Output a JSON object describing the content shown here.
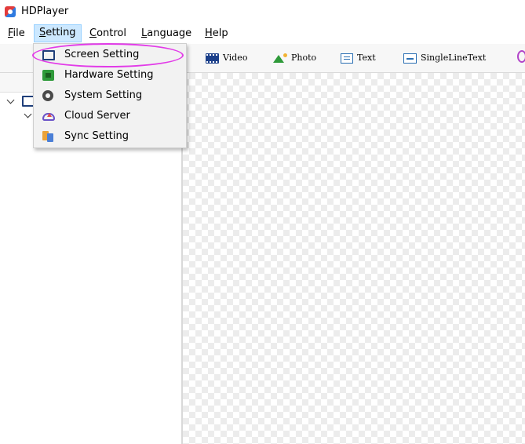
{
  "window": {
    "title": "HDPlayer",
    "app_icon": "hdplayer-app-icon"
  },
  "menubar": {
    "items": [
      {
        "label": "File",
        "accel": "F",
        "rest": "ile",
        "active": false
      },
      {
        "label": "Setting",
        "accel": "S",
        "rest": "etting",
        "active": true
      },
      {
        "label": "Control",
        "accel": "C",
        "rest": "ontrol",
        "active": false
      },
      {
        "label": "Language",
        "accel": "L",
        "rest": "anguage",
        "active": false
      },
      {
        "label": "Help",
        "accel": "H",
        "rest": "elp",
        "active": false
      }
    ]
  },
  "toolbar": {
    "items": [
      {
        "label": "Video",
        "icon": "video-icon"
      },
      {
        "label": "Photo",
        "icon": "photo-icon"
      },
      {
        "label": "Text",
        "icon": "text-icon"
      },
      {
        "label": "SingleLineText",
        "icon": "single-line-text-icon"
      }
    ]
  },
  "setting_menu": {
    "items": [
      {
        "label": "Screen Setting",
        "icon": "screen-icon"
      },
      {
        "label": "Hardware Setting",
        "icon": "chip-icon"
      },
      {
        "label": "System Setting",
        "icon": "gear-icon"
      },
      {
        "label": "Cloud Server",
        "icon": "cloud-upload-icon"
      },
      {
        "label": "Sync Setting",
        "icon": "sync-icon"
      }
    ]
  },
  "colors": {
    "menu_active_bg": "#cce8ff",
    "highlight_annotation": "#e23be8",
    "screen_icon": "#1f3f7a"
  }
}
